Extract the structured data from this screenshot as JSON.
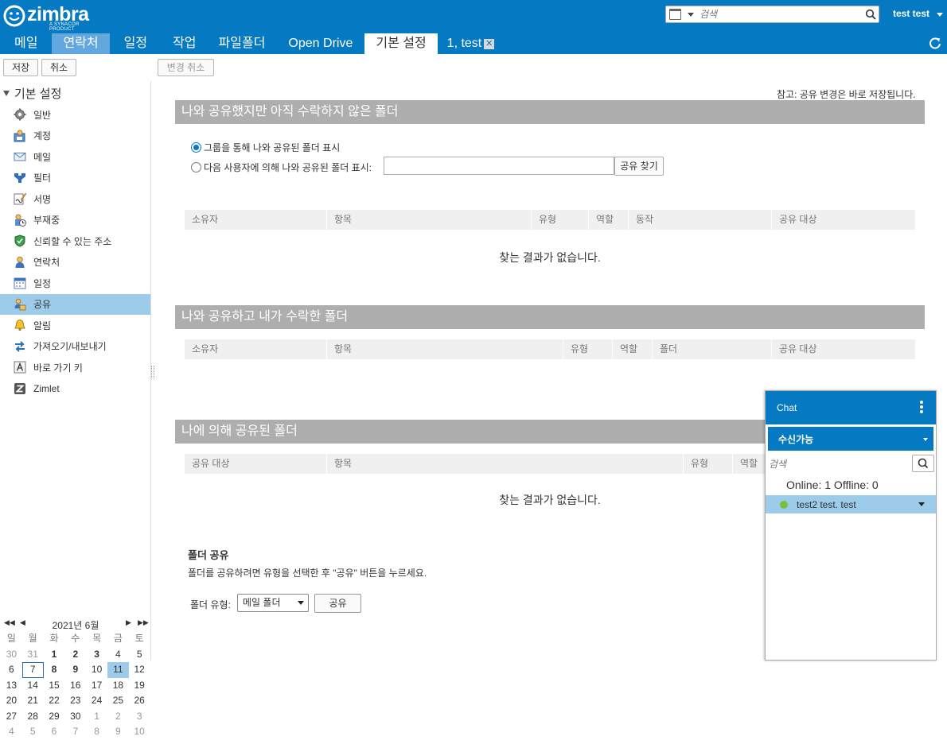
{
  "header": {
    "logo_text": "zimbra",
    "logo_tagline": "A SYNACOR PRODUCT",
    "search_placeholder": "검색",
    "user_name": "test test",
    "tabs": [
      {
        "label": "메일"
      },
      {
        "label": "연락처"
      },
      {
        "label": "일정"
      },
      {
        "label": "작업"
      },
      {
        "label": "파일폴더"
      },
      {
        "label": "Open Drive"
      },
      {
        "label": "기본 설정"
      },
      {
        "label": "1, test"
      }
    ]
  },
  "toolbar": {
    "save_label": "저장",
    "cancel_label": "취소",
    "revert_label": "변경 취소"
  },
  "sidebar": {
    "tree_title": "기본 설정",
    "items": [
      {
        "label": "일반",
        "icon": "gear-icon"
      },
      {
        "label": "계정",
        "icon": "account-icon"
      },
      {
        "label": "메일",
        "icon": "envelope-icon"
      },
      {
        "label": "필터",
        "icon": "filter-icon"
      },
      {
        "label": "서명",
        "icon": "signature-icon"
      },
      {
        "label": "부재중",
        "icon": "out-of-office-icon"
      },
      {
        "label": "신뢰할 수 있는 주소",
        "icon": "shield-icon"
      },
      {
        "label": "연락처",
        "icon": "contact-icon"
      },
      {
        "label": "일정",
        "icon": "calendar-icon"
      },
      {
        "label": "공유",
        "icon": "share-icon"
      },
      {
        "label": "알림",
        "icon": "bell-icon"
      },
      {
        "label": "가져오기/내보내기",
        "icon": "import-export-icon"
      },
      {
        "label": "바로 가기 키",
        "icon": "keyboard-shortcut-icon"
      },
      {
        "label": "Zimlet",
        "icon": "zimlet-icon"
      }
    ]
  },
  "minical": {
    "title": "2021년 6월",
    "weekdays": [
      "일",
      "월",
      "화",
      "수",
      "목",
      "금",
      "토"
    ],
    "weeks": [
      [
        "30",
        "31",
        "1",
        "2",
        "3",
        "4",
        "5"
      ],
      [
        "6",
        "7",
        "8",
        "9",
        "10",
        "11",
        "12"
      ],
      [
        "13",
        "14",
        "15",
        "16",
        "17",
        "18",
        "19"
      ],
      [
        "20",
        "21",
        "22",
        "23",
        "24",
        "25",
        "26"
      ],
      [
        "27",
        "28",
        "29",
        "30",
        "1",
        "2",
        "3"
      ],
      [
        "4",
        "5",
        "6",
        "7",
        "8",
        "9",
        "10"
      ]
    ],
    "today": "7",
    "selected": "11"
  },
  "main": {
    "note": "참고: 공유 변경은 바로 저장됩니다.",
    "section1": {
      "title": "나와 공유했지만 아직 수락하지 않은 폴더",
      "radio1": "그룹을 통해 나와 공유된 폴더 표시",
      "radio2": "다음 사용자에 의해 나와 공유된 폴더 표시:",
      "find_button": "공유 찾기",
      "columns": [
        "소유자",
        "항목",
        "유형",
        "역할",
        "동작",
        "공유 대상"
      ],
      "empty": "찾는 결과가 없습니다."
    },
    "section2": {
      "title": "나와 공유하고 내가 수락한 폴더",
      "columns": [
        "소유자",
        "항목",
        "유형",
        "역할",
        "폴더",
        "공유 대상"
      ]
    },
    "section3": {
      "title": "나에 의해 공유된 폴더",
      "columns": [
        "공유 대상",
        "항목",
        "유형",
        "역할"
      ],
      "empty": "찾는 결과가 없습니다."
    },
    "folder_share": {
      "title": "폴더 공유",
      "description": "폴더를 공유하려면 유형을 선택한 후 \"공유\" 버튼을 누르세요.",
      "type_label": "폴더 유형:",
      "type_value": "메일 폴더",
      "share_button": "공유"
    }
  },
  "chat": {
    "title": "Chat",
    "status": "수신가능",
    "search_placeholder": "검색",
    "counts": "Online: 1 Offline: 0",
    "contact": "test2 test. test",
    "contact_status_color": "#7cbe3b"
  },
  "colors": {
    "brand_blue": "#0579c1",
    "selection": "#9dcbea",
    "section_header": "#aeaeae"
  }
}
